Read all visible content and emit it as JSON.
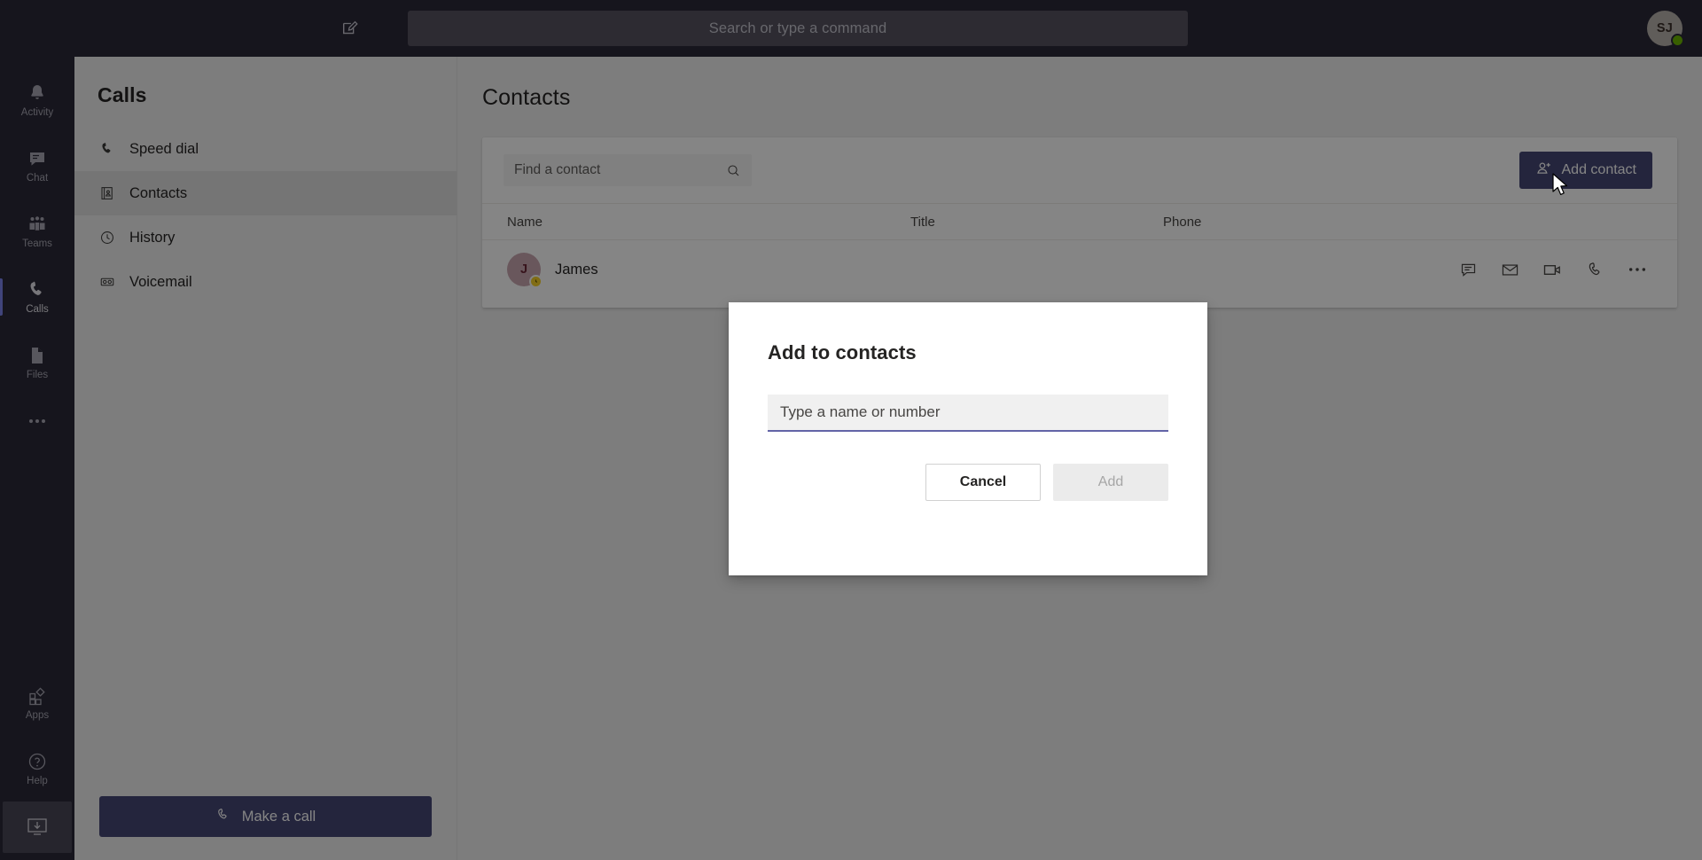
{
  "titlebar": {
    "compose_icon": "compose-icon",
    "search": {
      "placeholder": "Search or type a command"
    },
    "avatar": {
      "initials": "SJ",
      "presence": "available",
      "presence_color": "#6bb700"
    }
  },
  "rail": {
    "items": [
      {
        "label": "Activity",
        "icon": "bell-icon",
        "active": false
      },
      {
        "label": "Chat",
        "icon": "chat-icon",
        "active": false
      },
      {
        "label": "Teams",
        "icon": "teams-icon",
        "active": false
      },
      {
        "label": "Calls",
        "icon": "phone-icon",
        "active": true
      },
      {
        "label": "Files",
        "icon": "file-icon",
        "active": false
      }
    ],
    "more_label": "More apps",
    "bottom_items": [
      {
        "label": "Apps",
        "icon": "apps-icon"
      },
      {
        "label": "Help",
        "icon": "help-icon"
      }
    ],
    "download_label": "Download desktop app"
  },
  "panel": {
    "title": "Calls",
    "nav": [
      {
        "label": "Speed dial",
        "icon": "phone-icon",
        "active": false
      },
      {
        "label": "Contacts",
        "icon": "contacts-icon",
        "active": true
      },
      {
        "label": "History",
        "icon": "clock-icon",
        "active": false
      },
      {
        "label": "Voicemail",
        "icon": "voicemail-icon",
        "active": false
      }
    ],
    "make_call_label": "Make a call"
  },
  "content": {
    "title": "Contacts",
    "find_placeholder": "Find a contact",
    "find_value": "",
    "add_contact_label": "Add contact",
    "columns": {
      "name": "Name",
      "title": "Title",
      "phone": "Phone"
    },
    "rows": [
      {
        "avatar_initial": "J",
        "name": "James",
        "title": "",
        "phone": "",
        "presence": "away",
        "presence_color": "#f8d22a",
        "actions": [
          "chat-icon",
          "email-icon",
          "video-call-icon",
          "audio-call-icon",
          "more-options-icon"
        ]
      }
    ]
  },
  "modal": {
    "title": "Add to contacts",
    "input_placeholder": "Type a name or number",
    "input_value": "",
    "cancel_label": "Cancel",
    "add_label": "Add",
    "add_disabled": true,
    "accent_color": "#6264a7"
  }
}
